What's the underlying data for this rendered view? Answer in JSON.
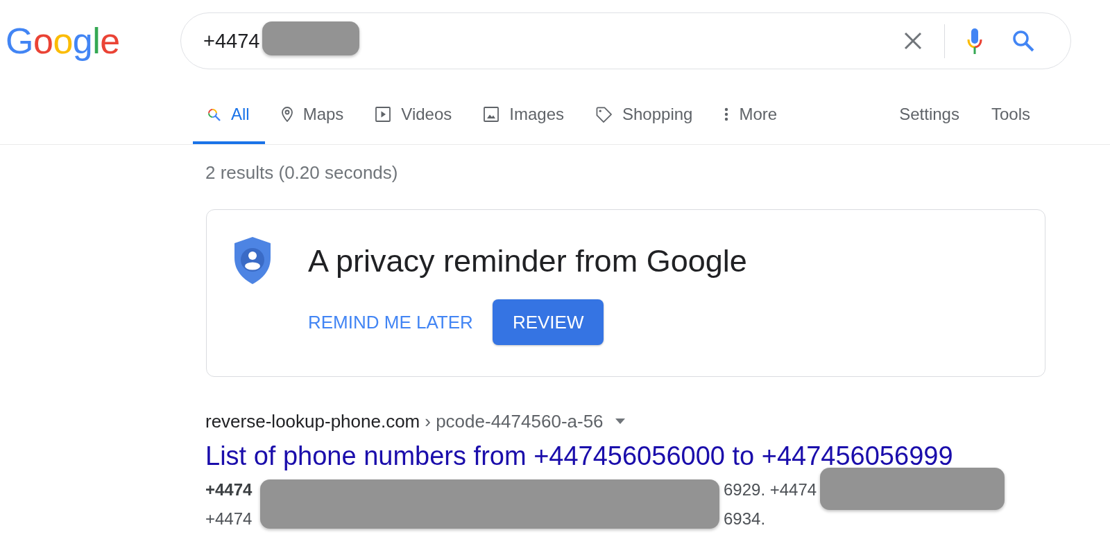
{
  "logo": "Google",
  "search": {
    "query": "+4474",
    "redacted": true
  },
  "tabs": [
    {
      "label": "All",
      "selected": true
    },
    {
      "label": "Maps",
      "selected": false
    },
    {
      "label": "Videos",
      "selected": false
    },
    {
      "label": "Images",
      "selected": false
    },
    {
      "label": "Shopping",
      "selected": false
    },
    {
      "label": "More",
      "selected": false
    }
  ],
  "tools": [
    "Settings",
    "Tools"
  ],
  "result_stats": "2 results (0.20 seconds)",
  "privacy_card": {
    "title": "A privacy reminder from Google",
    "buttons": [
      {
        "label": "REMIND ME LATER",
        "kind": "text"
      },
      {
        "label": "REVIEW",
        "kind": "filled"
      }
    ]
  },
  "results": [
    {
      "domain": "reverse-lookup-phone.com",
      "path": "› pcode-4474560-a-56",
      "title": "List of phone numbers from +447456056000 to +447456056999",
      "snippet": {
        "redacted": true,
        "lines": [
          [
            {
              "text": "+4474",
              "bold": true
            },
            {
              "text": "6929. +4474",
              "bold": false
            }
          ],
          [
            {
              "text": "+4474",
              "bold": false
            },
            {
              "text": "6934.",
              "bold": false
            }
          ]
        ]
      }
    }
  ]
}
